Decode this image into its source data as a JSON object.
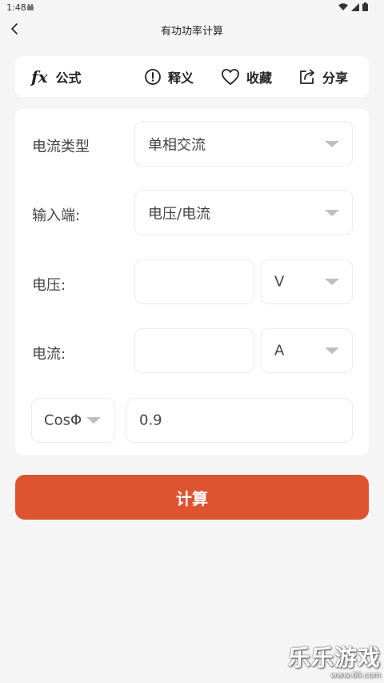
{
  "status_bar": {
    "time": "1:48"
  },
  "header": {
    "title": "有功功率计算"
  },
  "tools": {
    "formula_icon": "fx",
    "formula_label": "公式",
    "explain_label": "释义",
    "favorite_label": "收藏",
    "share_label": "分享"
  },
  "form": {
    "current_type": {
      "label": "电流类型",
      "value": "单相交流"
    },
    "input_end": {
      "label": "输入端:",
      "value": "电压/电流"
    },
    "voltage": {
      "label": "电压:",
      "value": "",
      "unit": "V"
    },
    "current": {
      "label": "电流:",
      "value": "",
      "unit": "A"
    },
    "power_factor": {
      "selector": "CosΦ",
      "value": "0.9"
    }
  },
  "calculate_label": "计算",
  "watermark": {
    "main": "乐乐游戏",
    "sub": "www.6ll.com"
  },
  "colors": {
    "accent": "#de5330",
    "background": "#f5f5f5",
    "card": "#ffffff"
  }
}
